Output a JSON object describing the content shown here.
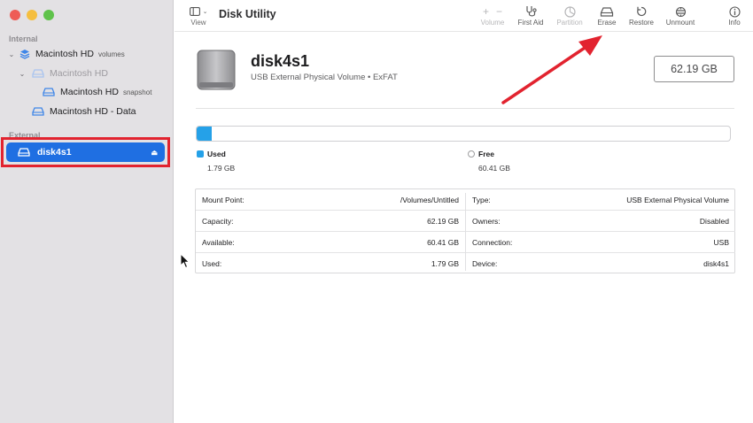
{
  "window": {
    "title": "Disk Utility"
  },
  "sidebar": {
    "sections": {
      "internal": "Internal",
      "external": "External"
    },
    "items": [
      {
        "label": "Macintosh HD",
        "sub": "volumes"
      },
      {
        "label": "Macintosh HD",
        "sub": ""
      },
      {
        "label": "Macintosh HD",
        "sub": "snapshot"
      },
      {
        "label": "Macintosh HD - Data",
        "sub": ""
      }
    ],
    "selected": {
      "label": "disk4s1"
    }
  },
  "toolbar": {
    "view_label": "View",
    "volume_label": "Volume",
    "first_aid_label": "First Aid",
    "partition_label": "Partition",
    "erase_label": "Erase",
    "restore_label": "Restore",
    "unmount_label": "Unmount",
    "info_label": "Info"
  },
  "disk": {
    "name": "disk4s1",
    "subtitle": "USB External Physical Volume • ExFAT",
    "size": "62.19 GB",
    "used_fraction": 0.029
  },
  "usage": {
    "used_label": "Used",
    "used_value": "1.79 GB",
    "free_label": "Free",
    "free_value": "60.41 GB"
  },
  "info": {
    "left": [
      {
        "key": "Mount Point:",
        "value": "/Volumes/Untitled"
      },
      {
        "key": "Capacity:",
        "value": "62.19 GB"
      },
      {
        "key": "Available:",
        "value": "60.41 GB"
      },
      {
        "key": "Used:",
        "value": "1.79 GB"
      }
    ],
    "right": [
      {
        "key": "Type:",
        "value": "USB External Physical Volume"
      },
      {
        "key": "Owners:",
        "value": "Disabled"
      },
      {
        "key": "Connection:",
        "value": "USB"
      },
      {
        "key": "Device:",
        "value": "disk4s1"
      }
    ]
  },
  "colors": {
    "accent": "#1f6fe2",
    "usage_fill": "#25a1e8",
    "highlight": "#e2232f"
  }
}
